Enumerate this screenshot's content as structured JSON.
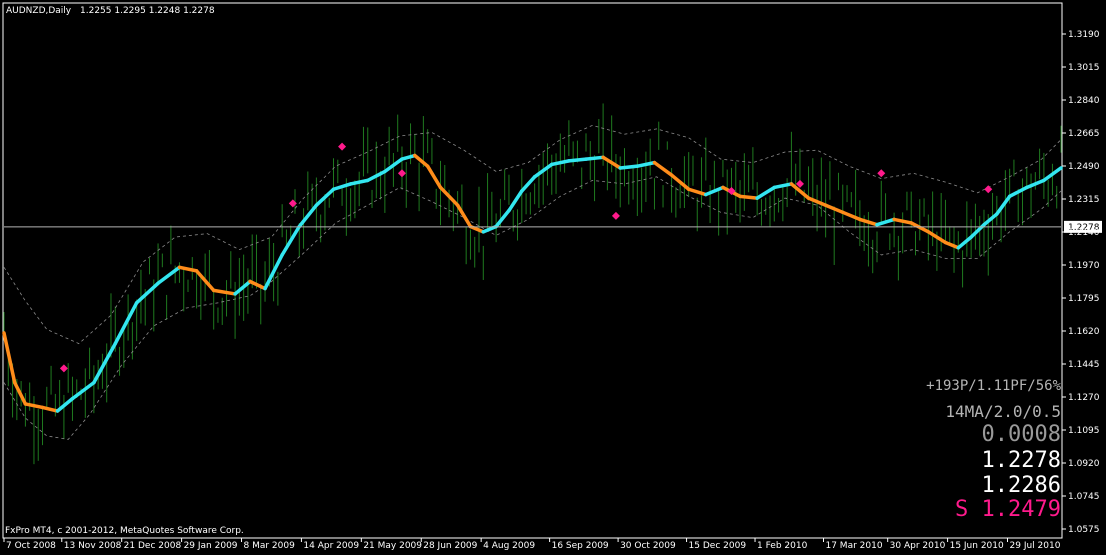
{
  "header": {
    "symbol": "AUDNZD,Daily",
    "ohlc": "1.2255 1.2295 1.2248 1.2278"
  },
  "footer": {
    "copyright": "FxPro MT4, c 2001-2012, MetaQuotes Software Corp."
  },
  "info_panel": {
    "stats": "+193P/1.11PF/56%",
    "params": "14MA/2.0/0.5",
    "value": "0.0008",
    "price1": "1.2278",
    "price2": "1.2286",
    "signal": "S 1.2479"
  },
  "colors": {
    "background": "#000000",
    "candles": "#1f7a1f",
    "ma_up": "#33e6f0",
    "ma_down": "#ff8c1a",
    "band": "#8c8c8c",
    "signal_marker": "#ff1a8c",
    "price_line": "#b4b4b4",
    "frame": "#ffffff"
  },
  "chart_data": {
    "type": "line",
    "title": "AUDNZD,Daily",
    "current_price": 1.2278,
    "ylim": [
      1.0575,
      1.3365
    ],
    "y_ticks": [
      "1.3190",
      "1.3015",
      "1.2840",
      "1.2665",
      "1.2490",
      "1.2315",
      "1.2140",
      "1.1970",
      "1.1795",
      "1.1620",
      "1.1445",
      "1.1270",
      "1.1095",
      "1.0920",
      "1.0745",
      "1.0575"
    ],
    "x_ticks": [
      "7 Oct 2008",
      "13 Nov 2008",
      "21 Dec 2008",
      "29 Jan 2009",
      "8 Mar 2009",
      "14 Apr 2009",
      "21 May 2009",
      "28 Jun 2009",
      "4 Aug 2009",
      "16 Sep 2009",
      "30 Oct 2009",
      "15 Dec 2009",
      "1 Feb 2010",
      "17 Mar 2010",
      "30 Apr 2010",
      "15 Jun 2010",
      "29 Jul 2010"
    ],
    "x_tick_bar_index": [
      0,
      27,
      55,
      83,
      111,
      139,
      167,
      195,
      223,
      255,
      287,
      319,
      351,
      383,
      413,
      441,
      469
    ],
    "bar_count": 495,
    "series": [
      {
        "role": "moving-average",
        "points": [
          [
            0,
            1.168
          ],
          [
            5,
            1.14
          ],
          [
            10,
            1.128
          ],
          [
            18,
            1.126
          ],
          [
            25,
            1.124
          ],
          [
            32,
            1.131
          ],
          [
            42,
            1.14
          ],
          [
            52,
            1.162
          ],
          [
            62,
            1.185
          ],
          [
            72,
            1.196
          ],
          [
            82,
            1.205
          ],
          [
            90,
            1.203
          ],
          [
            98,
            1.192
          ],
          [
            108,
            1.19
          ],
          [
            115,
            1.197
          ],
          [
            122,
            1.193
          ],
          [
            130,
            1.212
          ],
          [
            138,
            1.228
          ],
          [
            146,
            1.24
          ],
          [
            154,
            1.249
          ],
          [
            162,
            1.252
          ],
          [
            170,
            1.254
          ],
          [
            178,
            1.259
          ],
          [
            186,
            1.266
          ],
          [
            192,
            1.268
          ],
          [
            198,
            1.262
          ],
          [
            204,
            1.25
          ],
          [
            212,
            1.24
          ],
          [
            218,
            1.228
          ],
          [
            224,
            1.225
          ],
          [
            230,
            1.228
          ],
          [
            236,
            1.237
          ],
          [
            242,
            1.248
          ],
          [
            248,
            1.256
          ],
          [
            256,
            1.263
          ],
          [
            264,
            1.265
          ],
          [
            272,
            1.266
          ],
          [
            280,
            1.267
          ],
          [
            288,
            1.261
          ],
          [
            296,
            1.262
          ],
          [
            304,
            1.264
          ],
          [
            312,
            1.257
          ],
          [
            320,
            1.249
          ],
          [
            328,
            1.246
          ],
          [
            336,
            1.25
          ],
          [
            344,
            1.245
          ],
          [
            352,
            1.244
          ],
          [
            360,
            1.25
          ],
          [
            368,
            1.252
          ],
          [
            376,
            1.244
          ],
          [
            384,
            1.24
          ],
          [
            392,
            1.236
          ],
          [
            400,
            1.232
          ],
          [
            408,
            1.229
          ],
          [
            416,
            1.232
          ],
          [
            424,
            1.23
          ],
          [
            432,
            1.225
          ],
          [
            440,
            1.219
          ],
          [
            446,
            1.216
          ],
          [
            452,
            1.222
          ],
          [
            458,
            1.229
          ],
          [
            464,
            1.235
          ],
          [
            470,
            1.245
          ],
          [
            478,
            1.25
          ],
          [
            486,
            1.254
          ],
          [
            494,
            1.261
          ]
        ]
      },
      {
        "role": "upper-band",
        "points": [
          [
            0,
            1.14
          ],
          [
            10,
            1.12
          ],
          [
            20,
            1.11
          ],
          [
            30,
            1.108
          ],
          [
            40,
            1.122
          ],
          [
            55,
            1.15
          ],
          [
            70,
            1.172
          ],
          [
            85,
            1.182
          ],
          [
            100,
            1.185
          ],
          [
            115,
            1.189
          ],
          [
            125,
            1.197
          ],
          [
            140,
            1.213
          ],
          [
            155,
            1.23
          ],
          [
            170,
            1.24
          ],
          [
            185,
            1.25
          ],
          [
            200,
            1.242
          ],
          [
            215,
            1.233
          ],
          [
            230,
            1.223
          ],
          [
            245,
            1.232
          ],
          [
            260,
            1.245
          ],
          [
            275,
            1.254
          ],
          [
            290,
            1.252
          ],
          [
            305,
            1.256
          ],
          [
            320,
            1.245
          ],
          [
            335,
            1.236
          ],
          [
            350,
            1.233
          ],
          [
            365,
            1.244
          ],
          [
            380,
            1.24
          ],
          [
            395,
            1.225
          ],
          [
            410,
            1.212
          ],
          [
            425,
            1.215
          ],
          [
            440,
            1.21
          ],
          [
            455,
            1.21
          ],
          [
            470,
            1.225
          ],
          [
            485,
            1.238
          ],
          [
            494,
            1.248
          ]
        ]
      },
      {
        "role": "lower-band",
        "points": [
          [
            0,
            1.205
          ],
          [
            10,
            1.186
          ],
          [
            20,
            1.17
          ],
          [
            35,
            1.162
          ],
          [
            50,
            1.178
          ],
          [
            65,
            1.208
          ],
          [
            80,
            1.222
          ],
          [
            95,
            1.224
          ],
          [
            110,
            1.215
          ],
          [
            125,
            1.222
          ],
          [
            140,
            1.244
          ],
          [
            155,
            1.262
          ],
          [
            170,
            1.27
          ],
          [
            185,
            1.279
          ],
          [
            200,
            1.281
          ],
          [
            215,
            1.271
          ],
          [
            230,
            1.259
          ],
          [
            245,
            1.264
          ],
          [
            260,
            1.277
          ],
          [
            275,
            1.285
          ],
          [
            290,
            1.28
          ],
          [
            305,
            1.283
          ],
          [
            320,
            1.278
          ],
          [
            335,
            1.266
          ],
          [
            350,
            1.264
          ],
          [
            365,
            1.27
          ],
          [
            380,
            1.271
          ],
          [
            395,
            1.262
          ],
          [
            410,
            1.255
          ],
          [
            425,
            1.258
          ],
          [
            440,
            1.253
          ],
          [
            455,
            1.247
          ],
          [
            470,
            1.256
          ],
          [
            485,
            1.266
          ],
          [
            494,
            1.277
          ]
        ]
      }
    ],
    "signal_markers": [
      [
        28,
        1.148
      ],
      [
        135,
        1.241
      ],
      [
        158,
        1.273
      ],
      [
        186,
        1.258
      ],
      [
        286,
        1.234
      ],
      [
        340,
        1.248
      ],
      [
        372,
        1.252
      ],
      [
        410,
        1.258
      ],
      [
        460,
        1.249
      ]
    ]
  }
}
